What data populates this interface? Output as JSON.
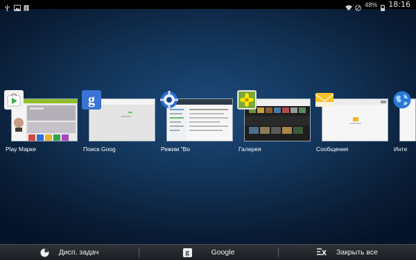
{
  "statusbar": {
    "left_icons": [
      "usb-icon",
      "image-notification-icon",
      "document-notification-icon"
    ],
    "battery": "48%",
    "time": "18:16"
  },
  "recent_apps": [
    {
      "label": "Play Марке",
      "icon": "play-store-icon"
    },
    {
      "label": "Поиск Goog",
      "icon": "google-search-icon"
    },
    {
      "label": "Режим \"Во",
      "icon": "settings-icon"
    },
    {
      "label": "Галерея",
      "icon": "gallery-icon"
    },
    {
      "label": "Сообщения",
      "icon": "messages-icon"
    },
    {
      "label": "Инте",
      "icon": "internet-icon"
    }
  ],
  "bottombar": {
    "task_manager": "Дисп. задач",
    "google": "Google",
    "close_all": "Закрыть все"
  },
  "colors": {
    "google_blue": "#3a74d4",
    "status_bar": "#000000",
    "bottom_bar": "#22272b"
  }
}
